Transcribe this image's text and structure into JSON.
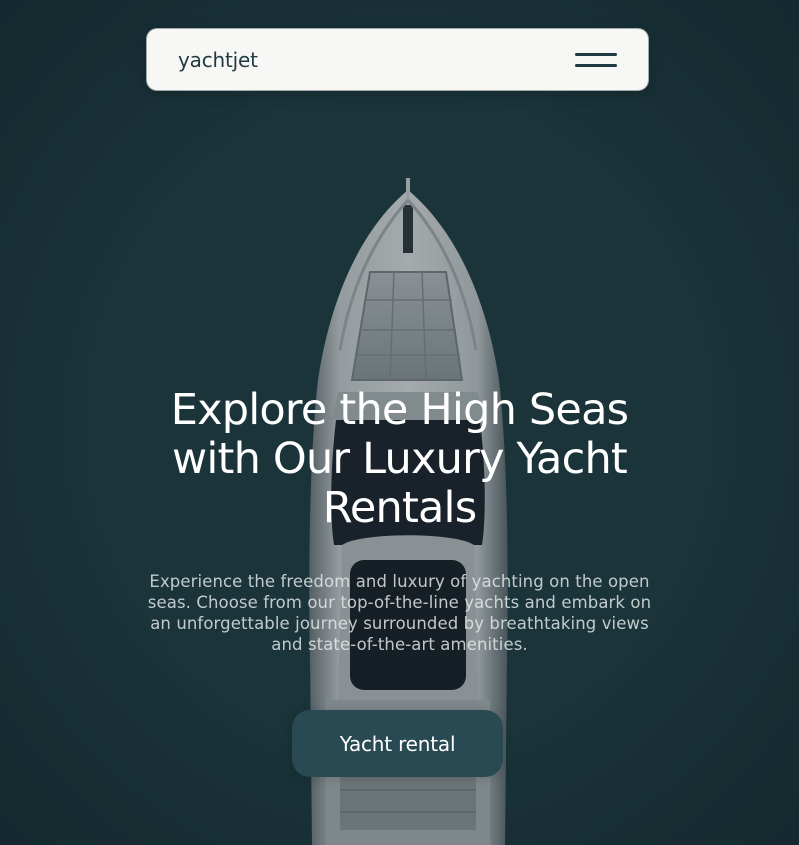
{
  "navbar": {
    "brand": "yachtjet",
    "menu_icon": "hamburger-menu-icon"
  },
  "hero": {
    "title": "Explore the High Seas with Our Luxury Yacht Rentals",
    "description": "Experience the freedom and luxury of yachting on the open seas. Choose from our top-of-the-line yachts and embark on an unforgettable journey surrounded by breathtaking views and state-of-the-art amenities.",
    "cta_label": "Yacht rental"
  },
  "colors": {
    "navbar_bg": "#f7f7f6",
    "brand_text": "#1f3a41",
    "water": "#1c3a41",
    "cta_bg": "#2a4a53",
    "hero_text": "#ffffff"
  }
}
